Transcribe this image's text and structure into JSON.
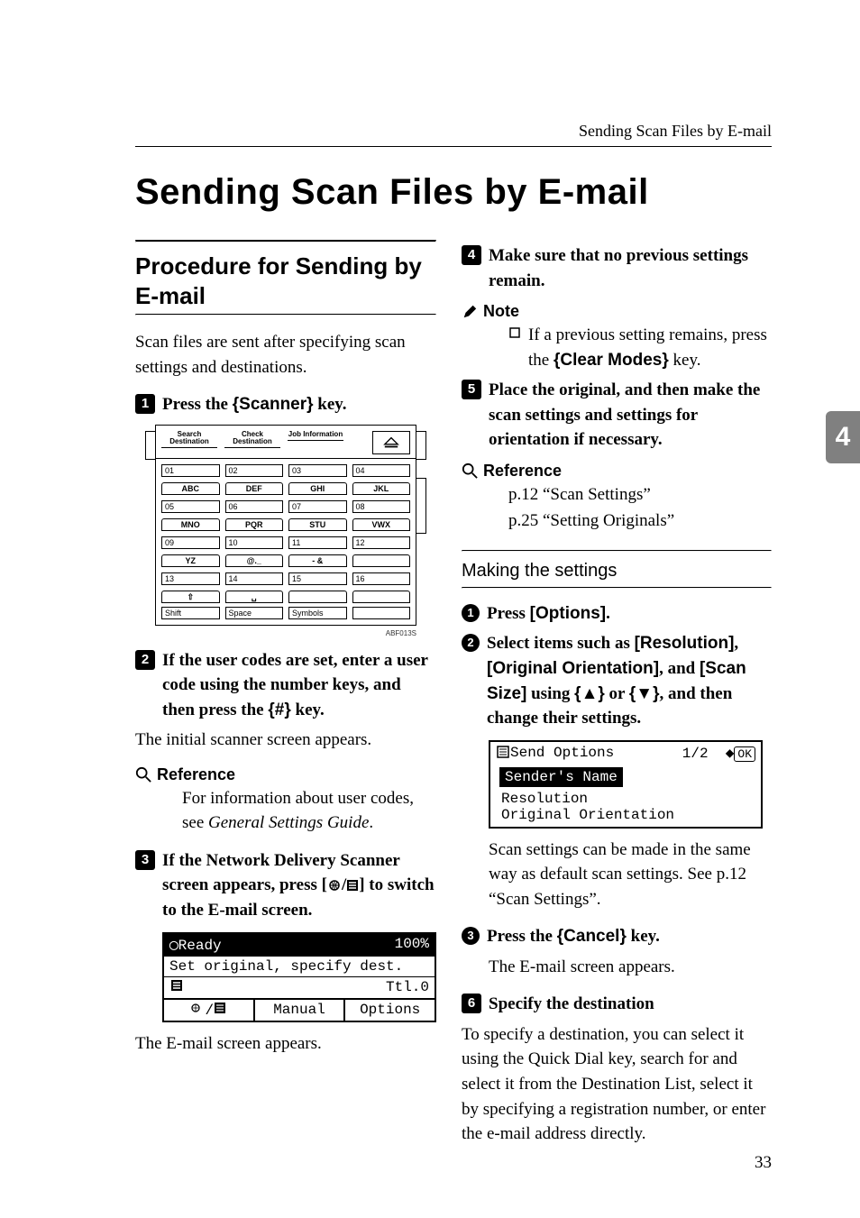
{
  "running_head": "Sending Scan Files by E-mail",
  "title": "Sending Scan Files by E-mail",
  "side_tab": "4",
  "page_number": "33",
  "left": {
    "section_title": "Procedure for Sending by E-mail",
    "intro": "Scan files are sent after specifying scan settings and destinations.",
    "step1_pre": "Press the ",
    "step1_key": "Scanner",
    "step1_post": " key.",
    "fig1": {
      "labels": [
        "Search Destination",
        "Check Destination",
        "Job Information"
      ],
      "rows_nums": [
        [
          "01",
          "02",
          "03",
          "04"
        ],
        [
          "05",
          "06",
          "07",
          "08"
        ],
        [
          "09",
          "10",
          "11",
          "12"
        ],
        [
          "13",
          "14",
          "15",
          "16"
        ]
      ],
      "rows_tabs": [
        [
          "ABC",
          "DEF",
          "GHI",
          "JKL"
        ],
        [
          "MNO",
          "PQR",
          "STU",
          "VWX"
        ],
        [
          "YZ",
          "@._",
          "- &",
          ""
        ],
        [
          "⇧",
          "␣",
          "",
          ""
        ]
      ],
      "bottom": [
        "Shift",
        "Space",
        "Symbols",
        ""
      ],
      "caption": "ABF013S"
    },
    "step2_text": "If the user codes are set, enter a user code using the number keys, and then press the ",
    "step2_key": "#",
    "step2_post": " key.",
    "step2_after": "The initial scanner screen appears.",
    "ref_label": "Reference",
    "ref_body": "For information about user codes, see General Settings Guide.",
    "step3_pre": "If the Network Delivery Scanner screen appears, press [",
    "step3_post": "] to switch to the E-mail screen.",
    "lcd1": {
      "status": "Ready",
      "pct": "100%",
      "line2": "Set original, specify dest.",
      "line3_right": "Ttl.0",
      "keys": [
        "",
        "Manual",
        "Options"
      ]
    },
    "after_lcd1": "The E-mail screen appears."
  },
  "right": {
    "step4": "Make sure that no previous settings remain.",
    "note_label": "Note",
    "note_body_pre": "If a previous setting remains, press the ",
    "note_key": "Clear Modes",
    "note_body_post": " key.",
    "step5": "Place the original, and then make the scan settings and settings for orientation if necessary.",
    "ref_label": "Reference",
    "ref_line1": "p.12 “Scan Settings”",
    "ref_line2": "p.25 “Setting Originals”",
    "subheading": "Making the settings",
    "b1_text": "Press [Options].",
    "b2_pre": "Select items such as ",
    "b2_key1": "[Resolution]",
    "b2_mid1": ", ",
    "b2_key2": "[Original Orientation]",
    "b2_mid2": ", and ",
    "b2_key3": "[Scan Size]",
    "b2_mid3": " using ",
    "b2_or": " or ",
    "b2_post": ", and then change their settings.",
    "lcd2": {
      "title": "Send Options",
      "page": "1/2",
      "selected": "Sender's Name",
      "opt1": "Resolution",
      "opt2": "Original Orientation"
    },
    "b2_after": "Scan settings can be made in the same way as default scan settings. See p.12 “Scan Settings”.",
    "b3_pre": "Press the ",
    "b3_key": "Cancel",
    "b3_post": " key.",
    "b3_after": "The E-mail screen appears.",
    "step6": "Specify the destination",
    "step6_body": "To specify a destination, you can select it using the Quick Dial key, search for and select it from the Destination List, select it by specifying a registration number, or enter the e-mail address directly."
  }
}
